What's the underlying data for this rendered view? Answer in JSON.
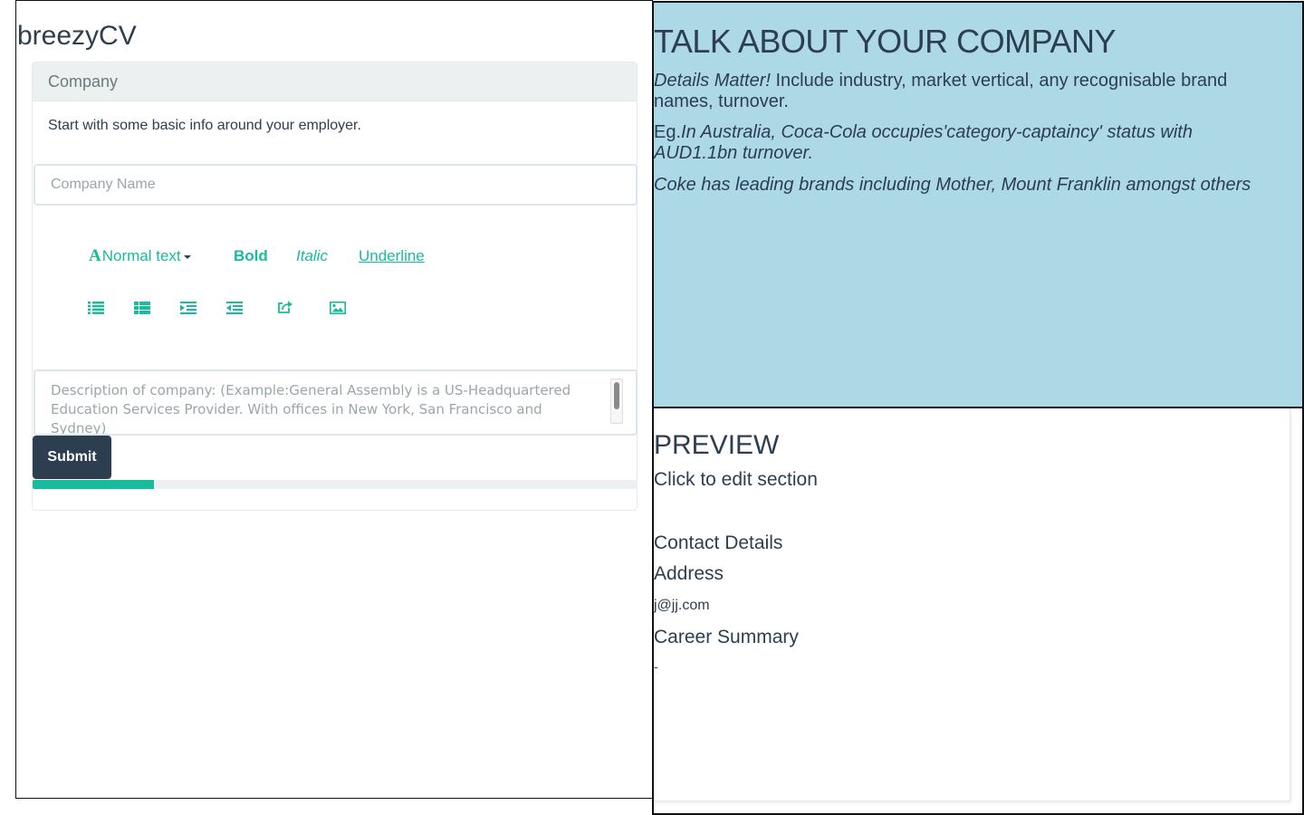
{
  "app": {
    "brand": "breezyCV"
  },
  "form": {
    "section_title": "Company",
    "intro": "Start with some basic info around your employer.",
    "company_name": {
      "value": "",
      "placeholder": "Company Name"
    },
    "toolbar": {
      "font_icon": "A",
      "normal_text": "Normal text",
      "bold": "Bold",
      "italic": "Italic",
      "underline": "Underline",
      "icons": [
        "bulleted-list-icon",
        "numbered-list-icon",
        "indent-icon",
        "outdent-icon",
        "link-icon",
        "image-icon"
      ]
    },
    "description": {
      "placeholder": "Description of company: (Example:General Assembly is a US-Headquartered Education Services Provider. With offices in New York, San Francisco and Sydney)"
    },
    "submit_label": "Submit",
    "progress": 0.2,
    "accent_color": "#18bc9c",
    "primary_color": "#2c3e50"
  },
  "guide": {
    "title": "TALK ABOUT YOUR COMPANY",
    "p1_emphasis": "Details Matter!",
    "p1_text": " Include industry, market vertical, any recognisable brand names, turnover.",
    "p2_prefix": "Eg.",
    "p2_text": "In Australia, Coca-Cola occupies'category-captaincy' status with AUD1.1bn turnover.",
    "p3_text": "Coke has leading brands including Mother, Mount Franklin amongst others",
    "background_color": "#add8e6"
  },
  "preview": {
    "title": "PREVIEW",
    "hint": "Click to edit section",
    "contact_details": "Contact Details",
    "address": "Address",
    "email": "j@jj.com",
    "career_summary": "Career Summary",
    "career_summary_value": "-"
  }
}
